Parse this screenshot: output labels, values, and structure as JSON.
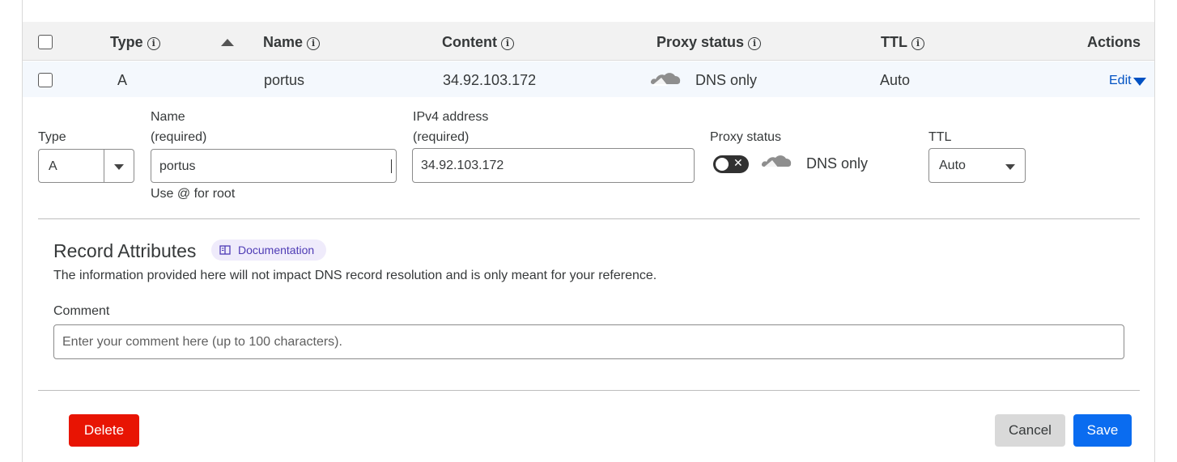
{
  "table": {
    "headers": {
      "type": "Type",
      "name": "Name",
      "content": "Content",
      "proxy_status": "Proxy status",
      "ttl": "TTL",
      "actions": "Actions"
    },
    "info_glyph": "i",
    "row": {
      "type": "A",
      "name": "portus",
      "content": "34.92.103.172",
      "proxy_status": "DNS only",
      "ttl": "Auto",
      "edit_label": "Edit"
    }
  },
  "edit_form": {
    "type": {
      "label": "Type",
      "value": "A"
    },
    "name": {
      "label": "Name",
      "required": "(required)",
      "value": "portus",
      "hint": "Use @ for root"
    },
    "ipv4": {
      "label": "IPv4 address",
      "required": "(required)",
      "value": "34.92.103.172"
    },
    "proxy": {
      "label": "Proxy status",
      "value": "DNS only",
      "toggle_on": false,
      "toggle_x": "✕"
    },
    "ttl": {
      "label": "TTL",
      "value": "Auto"
    }
  },
  "record_attributes": {
    "title": "Record Attributes",
    "doc_label": "Documentation",
    "description": "The information provided here will not impact DNS record resolution and is only meant for your reference.",
    "comment_label": "Comment",
    "comment_placeholder": "Enter your comment here (up to 100 characters)."
  },
  "buttons": {
    "delete": "Delete",
    "cancel": "Cancel",
    "save": "Save"
  },
  "colors": {
    "delete": "#e81403",
    "save": "#0a6cf0",
    "cancel": "#d9d9d9",
    "link": "#0051c3",
    "row_highlight": "#f4f8fd",
    "doc_pill": "#efebfb",
    "doc_text": "#4e3bb5"
  },
  "icons": [
    "info-icon",
    "sort-ascending-icon",
    "cloud-icon",
    "chevron-down-icon",
    "book-icon"
  ]
}
